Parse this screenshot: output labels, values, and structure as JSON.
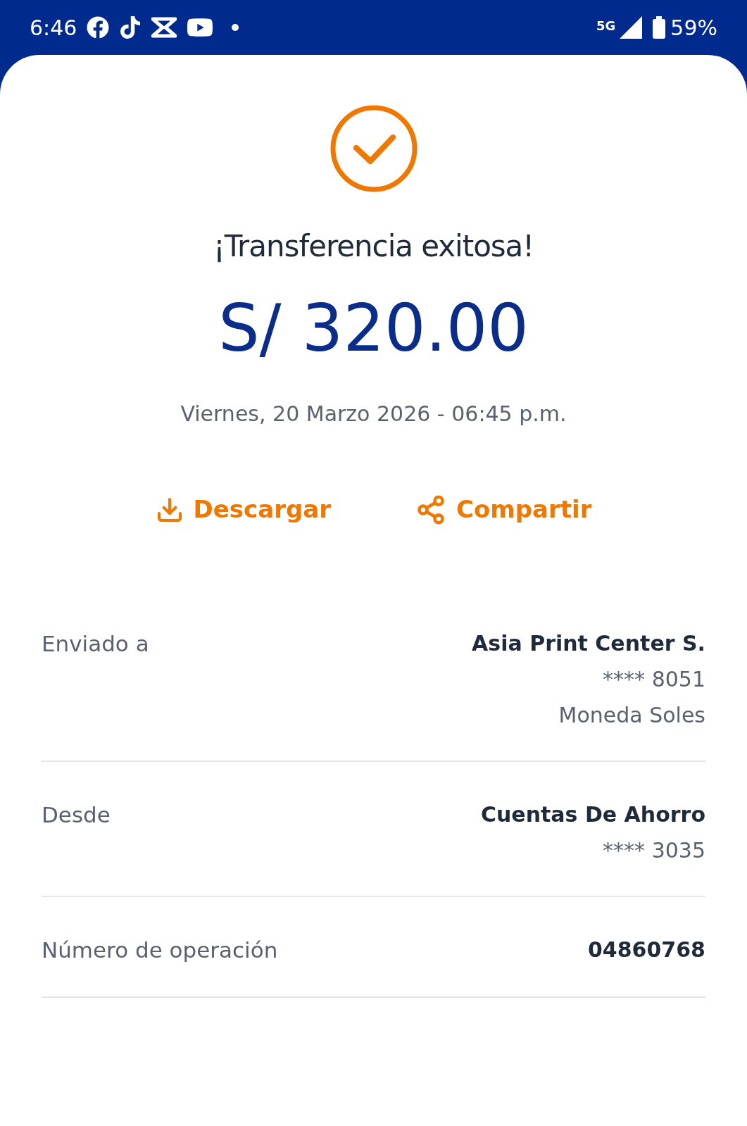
{
  "status_bar": {
    "time": "6:46",
    "network": "5G",
    "battery": "59%"
  },
  "title": "¡Transferencia exitosa!",
  "amount": "S/ 320.00",
  "date": "Viernes, 20 Marzo 2026 - 06:45 p.m.",
  "actions": [
    {
      "kind": "download",
      "label": "Descargar"
    },
    {
      "kind": "share",
      "label": "Compartir"
    }
  ],
  "details": [
    {
      "label": "Enviado a",
      "lines": [
        "Asia Print Center S.",
        "**** 8051",
        "Moneda Soles"
      ]
    },
    {
      "label": "Desde",
      "lines": [
        "Cuentas De Ahorro",
        "**** 3035"
      ]
    },
    {
      "label": "Número de operación",
      "lines": [
        "04860768"
      ]
    }
  ]
}
